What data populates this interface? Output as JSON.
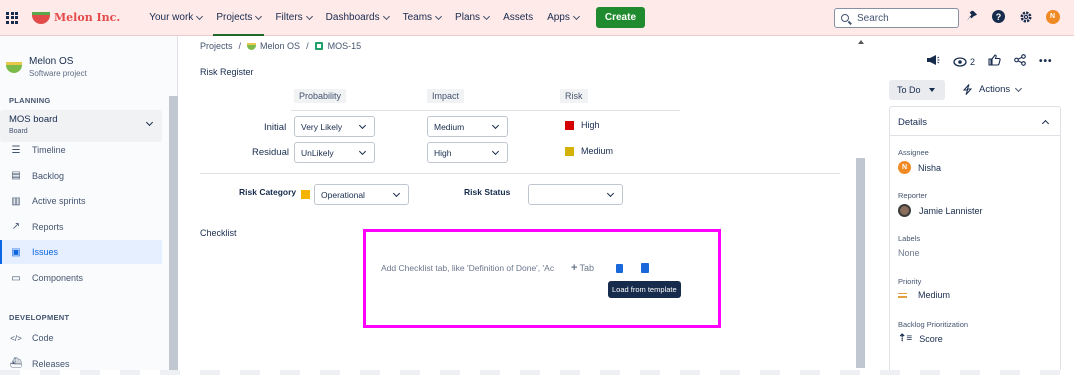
{
  "app": {
    "logo_text": "Melon Inc."
  },
  "topnav": {
    "items": [
      {
        "label": "Your work",
        "caret": true,
        "active": false
      },
      {
        "label": "Projects",
        "caret": true,
        "active": true
      },
      {
        "label": "Filters",
        "caret": true,
        "active": false
      },
      {
        "label": "Dashboards",
        "caret": true,
        "active": false
      },
      {
        "label": "Teams",
        "caret": true,
        "active": false
      },
      {
        "label": "Plans",
        "caret": true,
        "active": false
      },
      {
        "label": "Assets",
        "caret": false,
        "active": false
      },
      {
        "label": "Apps",
        "caret": true,
        "active": false
      }
    ],
    "create_label": "Create",
    "search_placeholder": "Search",
    "avatar_initial": "N"
  },
  "sidebar": {
    "project_name": "Melon OS",
    "project_type": "Software project",
    "planning_heading": "PLANNING",
    "board_name": "MOS board",
    "board_sub": "Board",
    "planning_items": [
      {
        "label": "Timeline",
        "icon": "timeline-icon"
      },
      {
        "label": "Backlog",
        "icon": "backlog-icon"
      },
      {
        "label": "Active sprints",
        "icon": "active-sprints-icon"
      },
      {
        "label": "Reports",
        "icon": "reports-icon"
      },
      {
        "label": "Issues",
        "icon": "issues-icon",
        "active": true
      },
      {
        "label": "Components",
        "icon": "components-icon"
      }
    ],
    "development_heading": "DEVELOPMENT",
    "development_items": [
      {
        "label": "Code",
        "icon": "code-icon"
      },
      {
        "label": "Releases",
        "icon": "releases-icon"
      }
    ]
  },
  "breadcrumb": {
    "projects": "Projects",
    "project": "Melon OS",
    "issue": "MOS-15"
  },
  "risk_register": {
    "title": "Risk Register",
    "columns": [
      "Probability",
      "Impact",
      "Risk"
    ],
    "rows": [
      {
        "label": "Initial",
        "probability": "Very Likely",
        "impact": "Medium",
        "risk": "High",
        "risk_color": "#d50000"
      },
      {
        "label": "Residual",
        "probability": "UnLikely",
        "impact": "High",
        "risk": "Medium",
        "risk_color": "#d4b106"
      }
    ],
    "category_label": "Risk Category",
    "category_value": "Operational",
    "category_color": "#f5b400",
    "status_label": "Risk Status",
    "status_value": ""
  },
  "checklist": {
    "title": "Checklist",
    "placeholder": "Add Checklist tab, like 'Definition of Done', 'Ac",
    "tab_label": "Tab",
    "tooltip": "Load from template"
  },
  "issue_panel": {
    "watchers_count": "2",
    "status": "To Do",
    "actions_label": "Actions",
    "details_heading": "Details",
    "fields": {
      "assignee_label": "Assignee",
      "assignee": "Nisha",
      "assignee_initial": "N",
      "reporter_label": "Reporter",
      "reporter": "Jamie Lannister",
      "labels_label": "Labels",
      "labels": "None",
      "priority_label": "Priority",
      "priority": "Medium",
      "backlog_label": "Backlog Prioritization",
      "backlog": "Score"
    }
  }
}
